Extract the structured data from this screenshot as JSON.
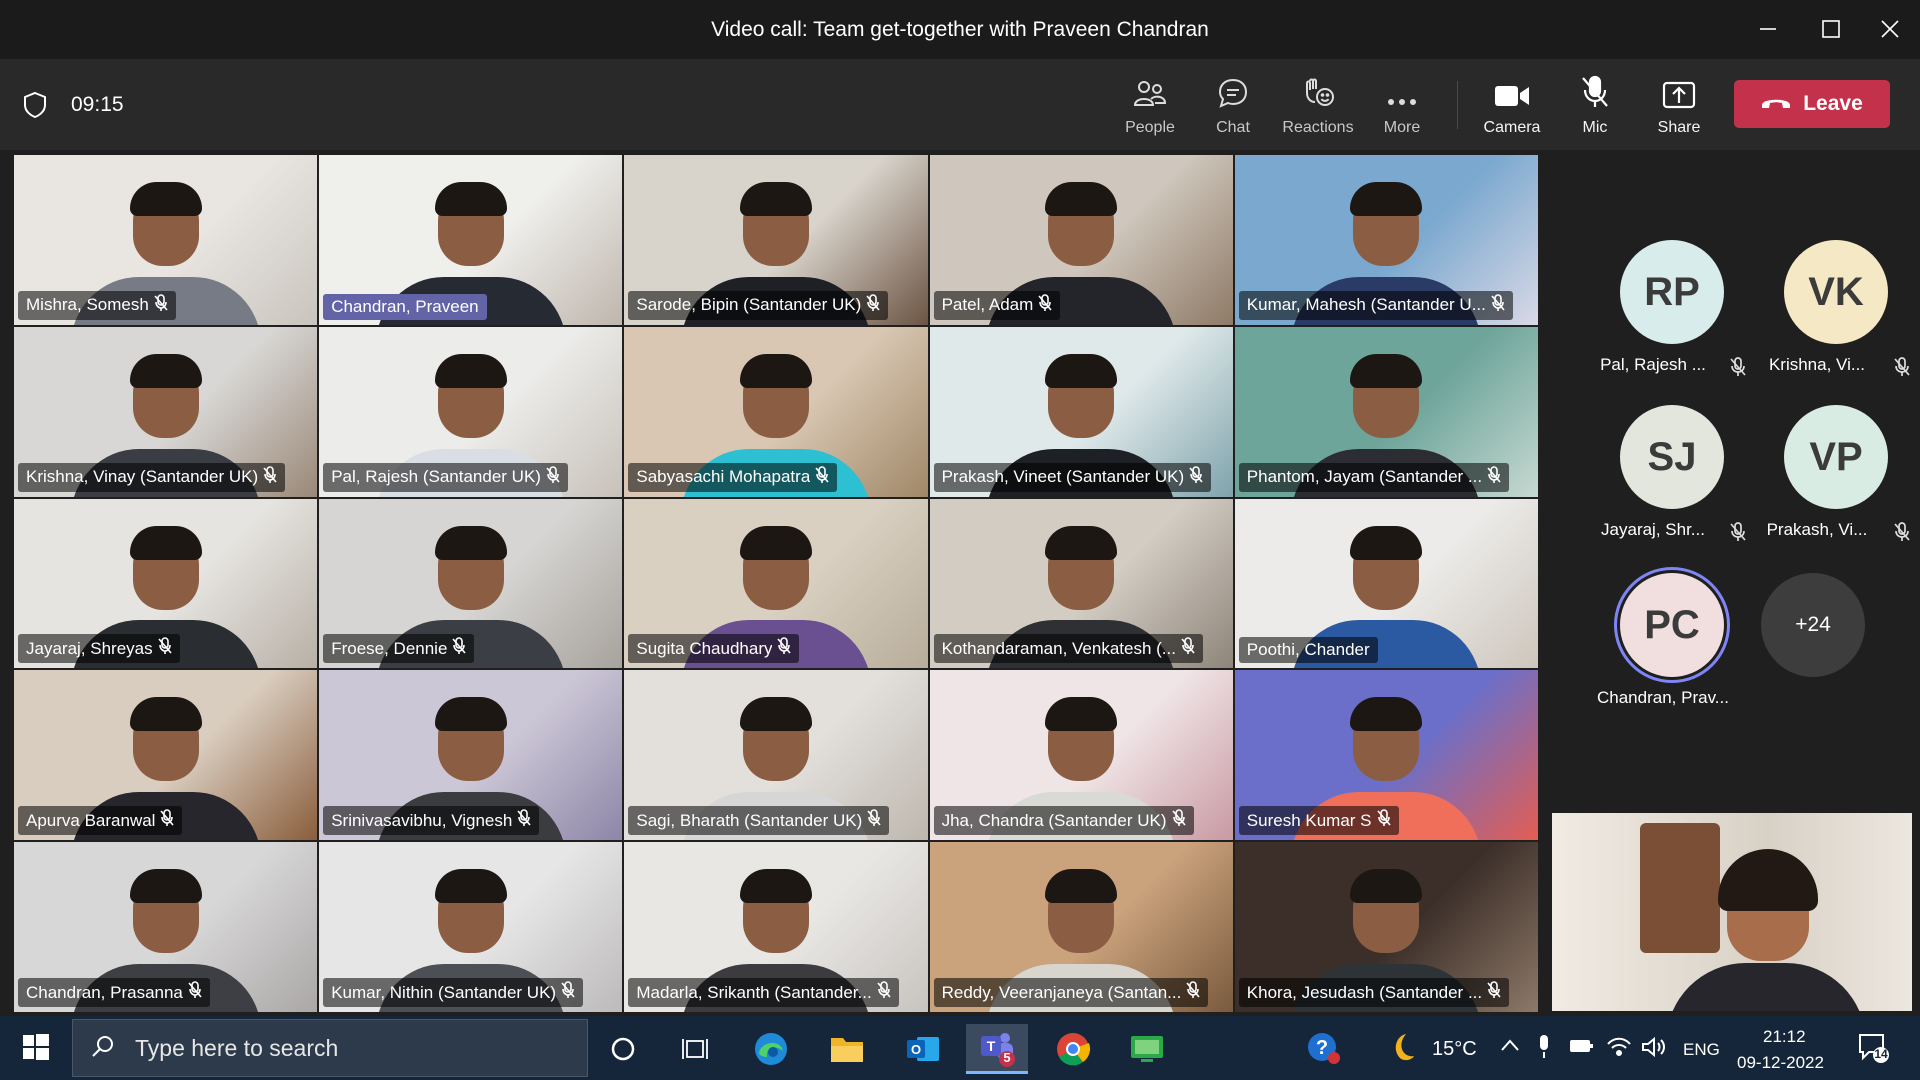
{
  "window": {
    "title": "Video call: Team get-together with Praveen Chandran",
    "controls": [
      "minimize",
      "maximize",
      "close"
    ]
  },
  "toolbar": {
    "timer": "09:15",
    "buttons": [
      {
        "label": "People",
        "icon": "people-icon"
      },
      {
        "label": "Chat",
        "icon": "chat-icon"
      },
      {
        "label": "Reactions",
        "icon": "reactions-icon"
      },
      {
        "label": "More",
        "icon": "more-icon"
      },
      {
        "label": "Camera",
        "icon": "camera-icon"
      },
      {
        "label": "Mic",
        "icon": "mic-off-icon"
      },
      {
        "label": "Share",
        "icon": "share-icon"
      }
    ],
    "leave_label": "Leave",
    "leave_color": "#c4314b"
  },
  "participants": [
    {
      "name": "Mishra, Somesh",
      "muted": true
    },
    {
      "name": "Chandran, Praveen",
      "muted": false,
      "active": true
    },
    {
      "name": "Sarode, Bipin (Santander UK)",
      "muted": true
    },
    {
      "name": "Patel, Adam",
      "muted": true
    },
    {
      "name": "Kumar, Mahesh (Santander U...",
      "muted": true
    },
    {
      "name": "Krishna, Vinay (Santander UK)",
      "muted": true
    },
    {
      "name": "Pal, Rajesh (Santander UK)",
      "muted": true
    },
    {
      "name": "Sabyasachi Mohapatra",
      "muted": true
    },
    {
      "name": "Prakash, Vineet (Santander UK)",
      "muted": true
    },
    {
      "name": "Phantom, Jayam (Santander ...",
      "muted": true
    },
    {
      "name": "Jayaraj, Shreyas",
      "muted": true
    },
    {
      "name": "Froese, Dennie",
      "muted": true
    },
    {
      "name": "Sugita Chaudhary",
      "muted": true
    },
    {
      "name": "Kothandaraman, Venkatesh (...",
      "muted": true
    },
    {
      "name": "Poothi, Chander",
      "muted": false
    },
    {
      "name": "Apurva Baranwal",
      "muted": true
    },
    {
      "name": "Srinivasavibhu, Vignesh",
      "muted": true
    },
    {
      "name": "Sagi, Bharath (Santander UK)",
      "muted": true
    },
    {
      "name": "Jha, Chandra (Santander UK)",
      "muted": true
    },
    {
      "name": "Suresh Kumar S",
      "muted": true
    },
    {
      "name": "Chandran, Prasanna",
      "muted": true
    },
    {
      "name": "Kumar, Nithin (Santander UK)",
      "muted": true
    },
    {
      "name": "Madarla, Srikanth (Santander...",
      "muted": true
    },
    {
      "name": "Reddy, Veeranjaneya (Santan...",
      "muted": true
    },
    {
      "name": "Khora, Jesudash (Santander ...",
      "muted": true
    }
  ],
  "avatars": [
    {
      "initials": "RP",
      "name": "Pal, Rajesh ...",
      "color": "#d9ecec",
      "muted": true
    },
    {
      "initials": "VK",
      "name": "Krishna, Vi...",
      "color": "#f5e8c4",
      "muted": true
    },
    {
      "initials": "SJ",
      "name": "Jayaraj, Shr...",
      "color": "#e3e6dd",
      "muted": true
    },
    {
      "initials": "VP",
      "name": "Prakash, Vi...",
      "color": "#d9ece3",
      "muted": true
    },
    {
      "initials": "PC",
      "name": "Chandran, Prav...",
      "color": "#f1dede",
      "muted": false,
      "speaking": true
    }
  ],
  "more_people": "+24",
  "taskbar": {
    "search_placeholder": "Type here to search",
    "apps": [
      "cortana-icon",
      "task-view-icon",
      "edge-icon",
      "file-explorer-icon",
      "outlook-icon",
      "teams-icon",
      "chrome-icon",
      "remote-desktop-icon"
    ],
    "teams_badge": "5",
    "weather": "15°C",
    "language": "ENG",
    "time": "21:12",
    "date": "09-12-2022",
    "notifications": "14"
  }
}
